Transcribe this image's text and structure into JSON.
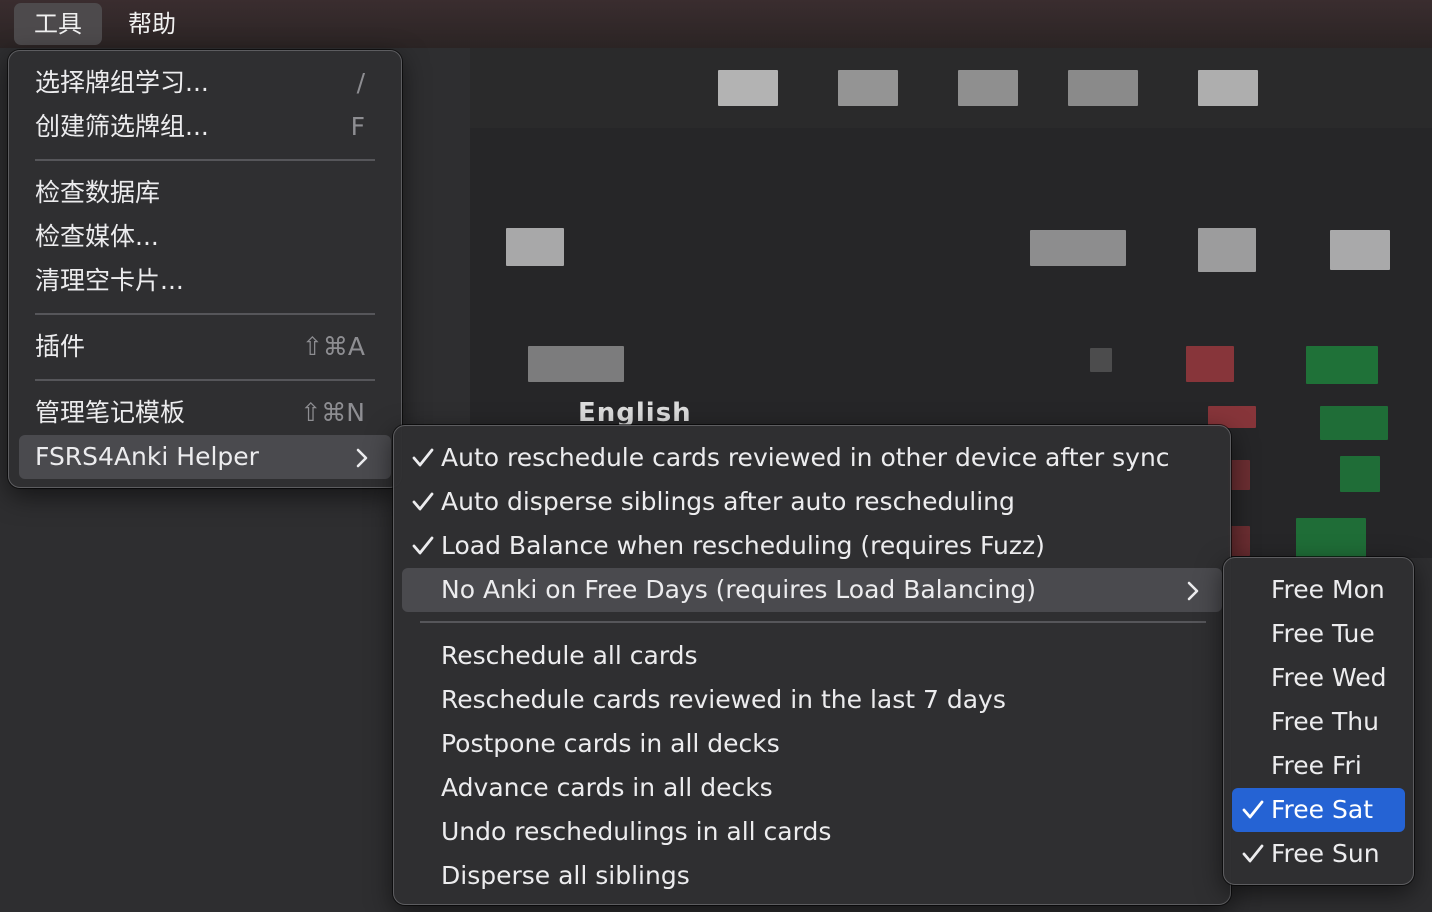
{
  "menubar": {
    "items": [
      {
        "label": "工具",
        "active": true
      },
      {
        "label": "帮助",
        "active": false
      }
    ]
  },
  "tools_menu": {
    "items": [
      {
        "label": "选择牌组学习...",
        "shortcut": "/"
      },
      {
        "label": "创建筛选牌组...",
        "shortcut": "F"
      },
      {
        "label": "检查数据库",
        "shortcut": ""
      },
      {
        "label": "检查媒体...",
        "shortcut": ""
      },
      {
        "label": "清理空卡片...",
        "shortcut": ""
      },
      {
        "label": "插件",
        "shortcut": "⇧⌘A"
      },
      {
        "label": "管理笔记模板",
        "shortcut": "⇧⌘N"
      },
      {
        "label": "FSRS4Anki Helper",
        "shortcut": "",
        "submenu": true,
        "highlighted": true
      }
    ]
  },
  "fsrs_menu": {
    "items": [
      {
        "label": "Auto reschedule cards reviewed in other device after sync",
        "checked": true
      },
      {
        "label": "Auto disperse siblings after auto rescheduling",
        "checked": true
      },
      {
        "label": "Load Balance when rescheduling (requires Fuzz)",
        "checked": true
      },
      {
        "label": "No Anki on Free Days (requires Load Balancing)",
        "checked": false,
        "submenu": true,
        "highlighted": true
      },
      {
        "label": "Reschedule all cards",
        "checked": false
      },
      {
        "label": "Reschedule cards reviewed in the last 7 days",
        "checked": false
      },
      {
        "label": "Postpone cards in all decks",
        "checked": false
      },
      {
        "label": "Advance cards in all decks",
        "checked": false
      },
      {
        "label": "Undo reschedulings in all cards",
        "checked": false
      },
      {
        "label": "Disperse all siblings",
        "checked": false
      }
    ]
  },
  "free_days_menu": {
    "items": [
      {
        "label": "Free Mon",
        "checked": false
      },
      {
        "label": "Free Tue",
        "checked": false
      },
      {
        "label": "Free Wed",
        "checked": false
      },
      {
        "label": "Free Thu",
        "checked": false
      },
      {
        "label": "Free Fri",
        "checked": false
      },
      {
        "label": "Free Sat",
        "checked": true,
        "selected": true
      },
      {
        "label": "Free Sun",
        "checked": true
      }
    ]
  },
  "background": {
    "partial_deck_name": "English"
  },
  "colors": {
    "selection": "#2563d4",
    "highlight": "#4a4a4e",
    "menu_bg": "#303032",
    "shortcut_text": "#8e8e92"
  }
}
